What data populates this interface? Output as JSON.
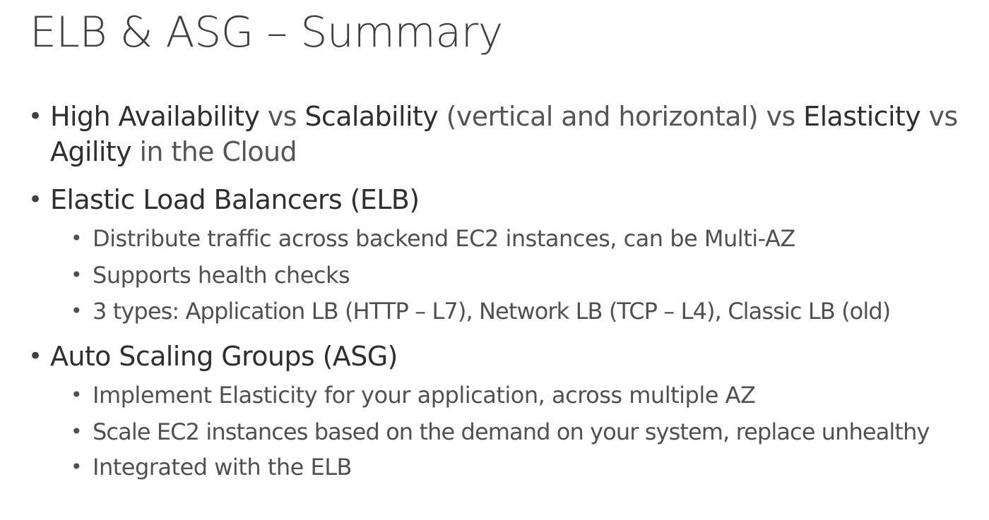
{
  "title": "ELB & ASG – Summary",
  "bullets": {
    "b1": {
      "part1": "High Availability",
      "part2": " vs ",
      "part3": "Scalability",
      "part4": " (vertical and horizontal) vs ",
      "part5": "Elasticity",
      "part6": " vs",
      "line2_part1": "Agility",
      "line2_part2": " in the Cloud"
    },
    "b2": {
      "label": "Elastic Load Balancers (ELB)",
      "subs": [
        "Distribute traffic across backend EC2 instances, can be Multi-AZ",
        "Supports health checks",
        "3 types: Application LB (HTTP – L7), Network LB (TCP – L4), Classic LB (old)"
      ]
    },
    "b3": {
      "label": "Auto Scaling Groups (ASG)",
      "subs": [
        "Implement Elasticity for your application, across multiple AZ",
        "Scale EC2 instances based on the demand on your system, replace unhealthy",
        "Integrated with the ELB"
      ]
    }
  },
  "bullet_glyph": "•"
}
